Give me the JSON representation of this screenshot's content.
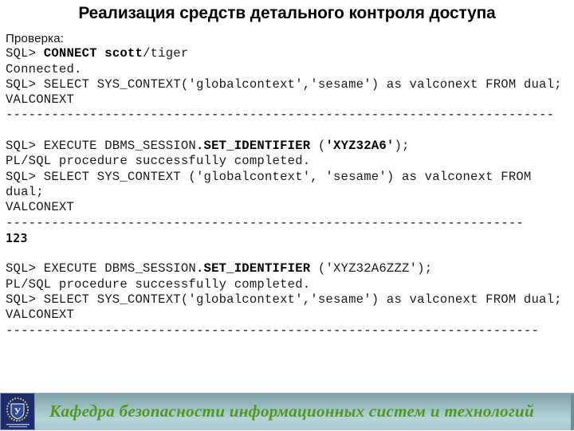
{
  "title": "Реализация средств детального контроля доступа",
  "lines": {
    "l0": "Проверка:",
    "l1a": "SQL> ",
    "l1b": "CONNECT scott",
    "l1c": "/tiger",
    "l2": "Connected.",
    "l3": "SQL> SELECT SYS_CONTEXT('globalcontext','sesame') as valconext FROM dual;",
    "l4": "VALCONEXT",
    "l5": "------------------------------------------------------------------------",
    "l7a": "SQL> EXECUTE DBMS_SESSION",
    "l7b": ".SET_IDENTIFIER",
    "l7c": " (",
    "l7d": "'XYZ32A6'",
    "l7e": ");",
    "l8": "PL/SQL procedure successfully completed.",
    "l9": "SQL> SELECT SYS_CONTEXT ('globalcontext', 'sesame') as valconext FROM",
    "l10": "dual;",
    "l11": "VALCONEXT",
    "l12": "--------------------------------------------------------------------",
    "l13": "123",
    "l15a": "SQL> EXECUTE DBMS_SESSION",
    "l15b": ".SET_IDENTIFIER",
    "l15c": " ('XYZ32A6ZZZ');",
    "l16": "PL/SQL procedure successfully completed.",
    "l17": "SQL> SELECT SYS_CONTEXT('globalcontext','sesame') as valconext FROM dual;",
    "l18": "VALCONEXT",
    "l19": "----------------------------------------------------------------------"
  },
  "footer": {
    "text": "Кафедра безопасности информационных систем и технологий",
    "logo_letter": "У"
  }
}
